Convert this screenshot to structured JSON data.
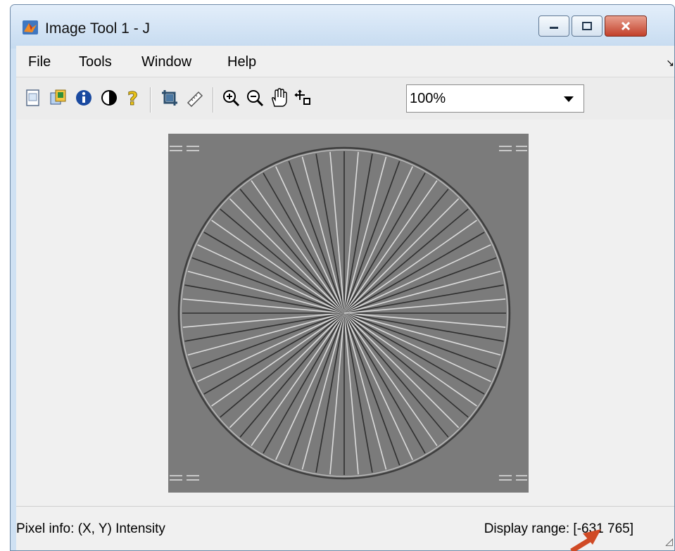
{
  "window": {
    "title": "Image Tool 1 - J",
    "app_icon": "matlab-icon"
  },
  "caption_buttons": {
    "minimize": "minimize-icon",
    "maximize": "maximize-icon",
    "close": "close-icon"
  },
  "menu": {
    "items": [
      "File",
      "Tools",
      "Window",
      "Help"
    ],
    "dock_arrow": "↘"
  },
  "toolbar": {
    "icons": [
      "new-figure-icon",
      "image-info-icon",
      "info-icon",
      "contrast-icon",
      "help-icon",
      "crop-icon",
      "measure-distance-icon",
      "zoom-in-icon",
      "zoom-out-icon",
      "pan-hand-icon",
      "pixel-region-icon"
    ],
    "zoom_value": "100%"
  },
  "image": {
    "description_icon": "star-chart-image",
    "spokes": 72
  },
  "status": {
    "pixel_info": "Pixel info: (X, Y)  Intensity",
    "display_range": "Display range: [-631 765]",
    "grip": "◿"
  },
  "colors": {
    "image_bg": "#7b7b7b",
    "callout": "#d04a25"
  }
}
